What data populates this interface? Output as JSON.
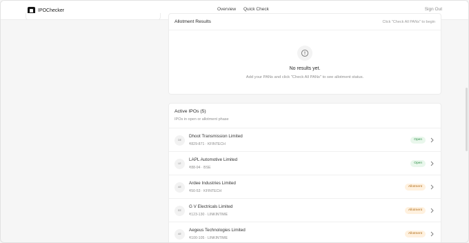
{
  "app": {
    "name": "IPOChecker"
  },
  "nav": {
    "overview": "Overview",
    "quick_check": "Quick Check",
    "sign_out": "Sign Out"
  },
  "results": {
    "title": "Allotment Results",
    "hint": "Click \"Check All PANs\" to begin",
    "empty_title": "No results yet.",
    "empty_sub": "Add your PANs and click \"Check All PANs\" to see allotment status.",
    "empty_icon": "alert-circle-icon"
  },
  "ipos": {
    "title": "Active IPOs (5)",
    "subtitle": "IPOs in open or allotment phase",
    "items": [
      {
        "initials": "DE",
        "name": "Dhoot Transmission Limited",
        "meta": "₹829-871 · KFINTECH",
        "status": "Open"
      },
      {
        "initials": "LE",
        "name": "LAPL Automotive Limited",
        "meta": "₹88-94 · BSE",
        "status": "Open"
      },
      {
        "initials": "AE",
        "name": "Ardee Industries Limited",
        "meta": "₹50-53 · KFINTECH",
        "status": "Allotment"
      },
      {
        "initials": "EE",
        "name": "G V Electricals Limited",
        "meta": "₹123-130 · LINKINTIME",
        "status": "Allotment"
      },
      {
        "initials": "AE",
        "name": "Aegeus Technologies Limited",
        "meta": "₹100-105 · LINKINTIME",
        "status": "Allotment"
      }
    ]
  }
}
